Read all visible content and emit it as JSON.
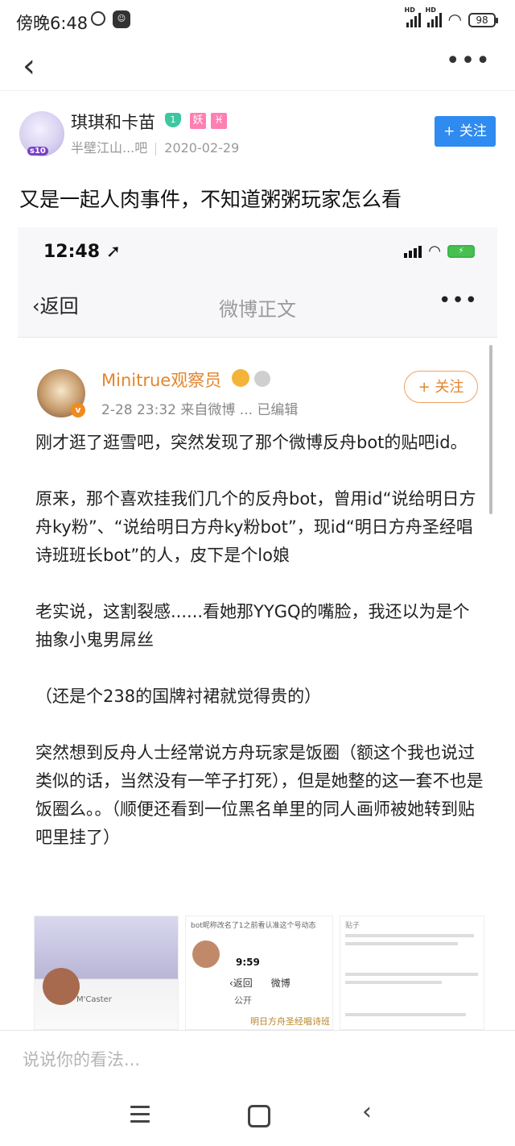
{
  "status_bar": {
    "time": "傍晚6:48",
    "battery": "98",
    "hd": "HD"
  },
  "nav": {
    "back": "‹",
    "more": "•••"
  },
  "author": {
    "name": "琪琪和卡苗",
    "level": "1",
    "tag1": "妖",
    "tag2": "♓",
    "badge": "s10",
    "forum": "半壁江山...吧",
    "date": "2020-02-29",
    "follow_label": "+ 关注"
  },
  "post": {
    "title": "又是一起人肉事件，不知道粥粥玩家怎么看"
  },
  "screenshot": {
    "status_time": "12:48",
    "back_label": "返回",
    "title": "微博正文",
    "more": "•••",
    "user_name": "Minitrue观察员",
    "meta": "2-28 23:32  来自微博 ...  已编辑",
    "follow_label": "+ 关注",
    "v_badge": "v",
    "paragraphs": [
      "刚才逛了逛雪吧，突然发现了那个微博反舟bot的贴吧id。",
      "原来，那个喜欢挂我们几个的反舟bot，曾用id“说给明日方舟ky粉”、“说给明日方舟ky粉bot”，现id“明日方舟圣经唱诗班班长bot”的人，皮下是个lo娘",
      "老实说，这割裂感......看她那YYGQ的嘴脸，我还以为是个抽象小鬼男屌丝",
      "（还是个238的国牌衬裙就觉得贵的）",
      "突然想到反舟人士经常说方舟玩家是饭圈（额这个我也说过类似的话，当然没有一竿子打死），但是她整的这一套不也是饭圈么。。（顺便还看到一位黑名单里的同人画师被她转到贴吧里挂了）"
    ],
    "thumbs": {
      "t1_caption": "M'Caster",
      "t2_top": "bot昵称改名了1之前看认准这个号动态",
      "t2_time": "9:59",
      "t2_back": "‹返回",
      "t2_weibo": "微博",
      "t2_public": "公开",
      "t2_highlight": "明日方舟圣经唱诗班",
      "t3_title": "贴子"
    }
  },
  "comment": {
    "placeholder": "说说你的看法..."
  },
  "system_nav": {
    "back": "‹"
  }
}
